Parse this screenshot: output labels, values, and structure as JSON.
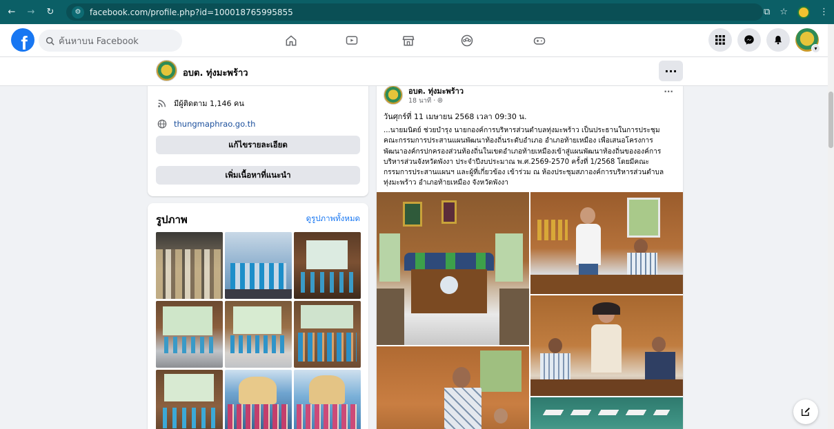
{
  "browser": {
    "url": "facebook.com/profile.php?id=100018765995855"
  },
  "fb": {
    "search_placeholder": "ค้นหาบน Facebook"
  },
  "page": {
    "name": "อบต. ทุ่งมะพร้าว",
    "more_label": "···"
  },
  "intro": {
    "followers": "มีผู้ติดตาม 1,146 คน",
    "website": "thungmaphrao.go.th",
    "edit_details_label": "แก้ไขรายละเอียด",
    "add_featured_label": "เพิ่มเนื้อหาที่แนะนำ"
  },
  "photos": {
    "title": "รูปภาพ",
    "see_all": "ดูรูปภาพทั้งหมด"
  },
  "post": {
    "author": "อบต. ทุ่งมะพร้าว",
    "time": "18 นาที · ",
    "more_label": "···",
    "date_line": "วันศุกร์ที่ 11 เมษายน 2568 เวลา 09:30 น.",
    "body_lines": [
      "...นายมนิตย์ ช่วยบำรุง นายกองค์การบริหารส่วนตำบลทุ่งมะพร้าว เป็นประธานในการประชุม",
      "คณะกรรมการประสานแผนพัฒนาท้องถิ่นระดับอำเภอ อำเภอท้ายเหมือง เพื่อเสนอโครงการ",
      "พัฒนาองค์กรปกครองส่วนท้องถิ่นในเขตอำเภอท้ายเหมืองเข้าสู่แผนพัฒนาท้องถิ่นขององค์การ",
      "บริหารส่วนจังหวัดพังงา ประจำปีงบประมาณ พ.ศ.2569-2570 ครั้งที่ 1/2568 โดยมีคณะ",
      "กรรมการประสานแผนฯ และผู้ที่เกี่ยวข้อง เข้าร่วม ณ ห้องประชุมสภาองค์การบริหารส่วนตำบล",
      "ทุ่งมะพร้าว อำเภอท้ายเหมือง จังหวัดพังงา"
    ]
  },
  "colors": {
    "chrome": "#0b5f66",
    "fb_blue": "#1877f2"
  }
}
